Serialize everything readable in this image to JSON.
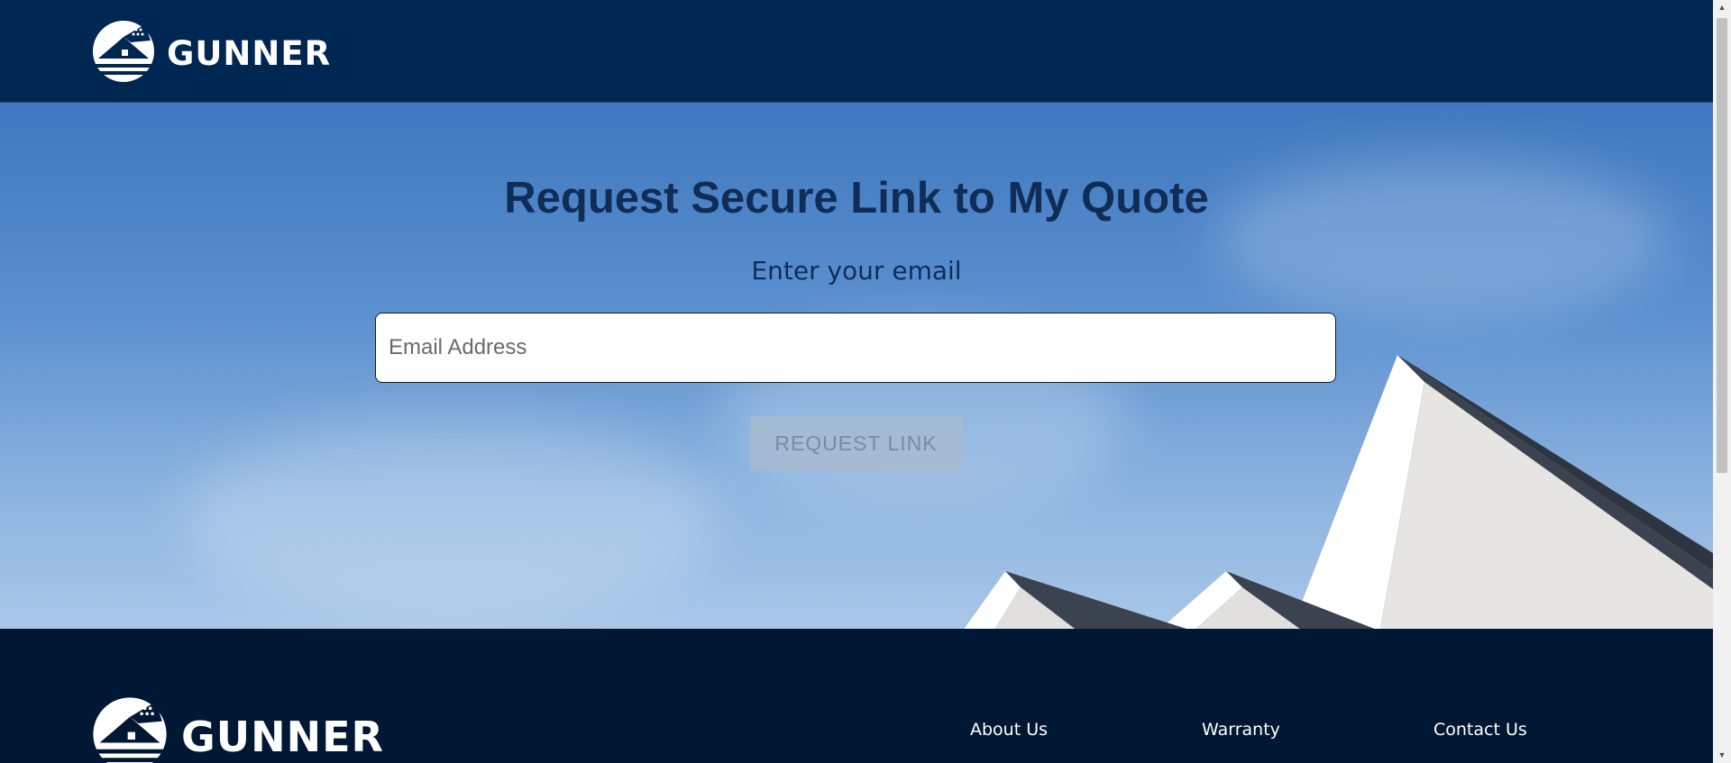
{
  "brand": {
    "name": "GUNNER",
    "logo_icon": "house-flag-icon"
  },
  "hero": {
    "title": "Request Secure Link to My Quote",
    "subtitle": "Enter your email",
    "email_placeholder": "Email Address",
    "email_value": "",
    "button_label": "REQUEST LINK"
  },
  "footer": {
    "links": [
      "About Us",
      "Warranty",
      "Contact Us"
    ]
  },
  "colors": {
    "header_bg": "#002652",
    "footer_bg": "#001833",
    "title_color": "#0f2d57",
    "button_bg": "#aab9cd"
  },
  "scrollbar": {
    "up_icon": "chevron-up-icon",
    "down_icon": "chevron-down-icon"
  }
}
